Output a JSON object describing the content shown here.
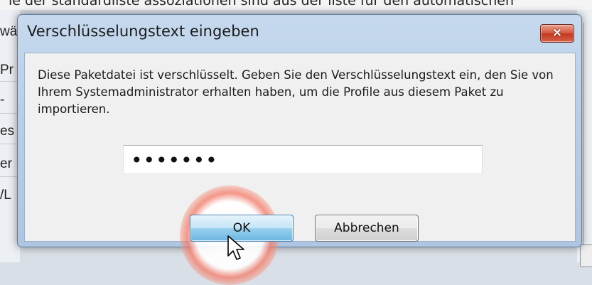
{
  "background": {
    "top_text": "ie der standardliste assoziationen sind aus der liste für den automatischen",
    "left_fragments": [
      "wä",
      "Pr",
      "-",
      "es",
      "er",
      "/L"
    ]
  },
  "dialog": {
    "title": "Verschlüsselungstext eingeben",
    "close_icon": "×",
    "message": "Diese Paketdatei ist verschlüsselt. Geben Sie den Verschlüsselungstext ein, den Sie von Ihrem Systemadministrator erhalten haben, um die Profile aus diesem Paket zu importieren.",
    "password_value": "•••••••",
    "ok_label": "OK",
    "cancel_label": "Abbrechen",
    "cursor": "arrow-cursor-icon",
    "accent_colors": {
      "titlebar": "#b9cfe8",
      "close_button": "#c2381f",
      "ok_button": "#98d1ef",
      "highlight_ring": "#f57864"
    }
  }
}
